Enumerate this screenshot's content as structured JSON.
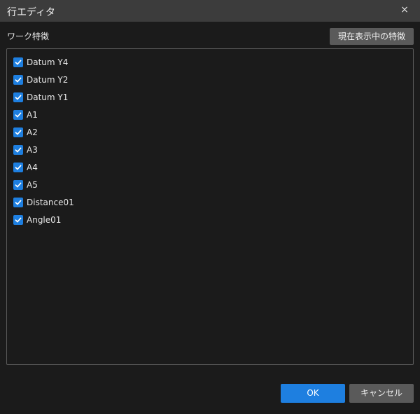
{
  "window": {
    "title": "行エディタ",
    "close_glyph": "×"
  },
  "section": {
    "label": "ワーク特徴",
    "current_features_button": "現在表示中の特徴"
  },
  "features": [
    {
      "label": "Datum Y4",
      "checked": true
    },
    {
      "label": "Datum Y2",
      "checked": true
    },
    {
      "label": "Datum Y1",
      "checked": true
    },
    {
      "label": "A1",
      "checked": true
    },
    {
      "label": "A2",
      "checked": true
    },
    {
      "label": "A3",
      "checked": true
    },
    {
      "label": "A4",
      "checked": true
    },
    {
      "label": "A5",
      "checked": true
    },
    {
      "label": "Distance01",
      "checked": true
    },
    {
      "label": "Angle01",
      "checked": true
    }
  ],
  "footer": {
    "ok_label": "OK",
    "cancel_label": "キャンセル"
  },
  "colors": {
    "accent": "#1e7fe0",
    "background": "#1b1b1b",
    "titlebar": "#3c3c3c",
    "button_secondary": "#5a5a5a"
  }
}
